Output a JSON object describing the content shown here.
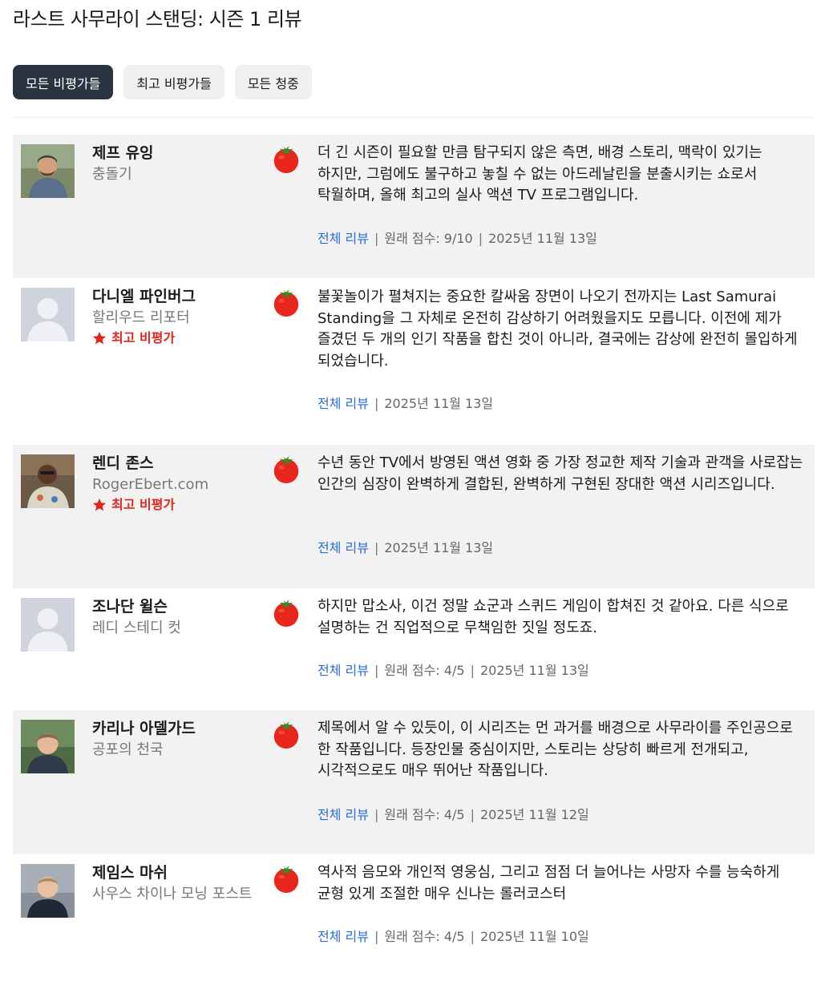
{
  "page": {
    "title": "라스트 사무라이 스탠딩: 시즌 1 리뷰"
  },
  "filters": [
    {
      "label": "모든 비평가들",
      "active": true
    },
    {
      "label": "최고 비평가들",
      "active": false
    },
    {
      "label": "모든 청중",
      "active": false
    }
  ],
  "top_critic_label": "최고 비평가",
  "full_review_label": "전체 리뷰",
  "colors": {
    "accent_link": "#2b6bd6",
    "top_critic": "#e0251b",
    "active_filter": "#2a3440",
    "tomato": "#e8261b"
  },
  "reviews": [
    {
      "name": "제프 유잉",
      "publication": "충돌기",
      "top_critic": false,
      "avatar": "photo",
      "icon": "fresh-tomato-icon",
      "quote": "더 긴 시즌이 필요할 만큼 탐구되지 않은 측면, 배경 스토리, 맥락이 있기는 하지만, 그럼에도 불구하고 놓칠 수 없는 아드레날린을 분출시키는 쇼로서 탁월하며, 올해 최고의 실사 액션 TV 프로그램입니다.",
      "score": "원래 점수: 9/10",
      "date": "2025년 11월 13일"
    },
    {
      "name": "다니엘 파인버그",
      "publication": "할리우드 리포터",
      "top_critic": true,
      "avatar": "placeholder",
      "icon": "fresh-tomato-icon",
      "quote": "불꽃놀이가 펼쳐지는 중요한 칼싸움 장면이 나오기 전까지는 Last Samurai Standing을 그 자체로 온전히 감상하기 어려웠을지도 모릅니다. 이전에 제가 즐겼던 두 개의 인기 작품을 합친 것이 아니라, 결국에는 감상에 완전히 몰입하게 되었습니다.",
      "score": "",
      "date": "2025년 11월 13일"
    },
    {
      "name": "렌디 존스",
      "publication": "RogerEbert.com",
      "top_critic": true,
      "avatar": "photo",
      "icon": "fresh-tomato-icon",
      "quote": "수년 동안 TV에서 방영된 액션 영화 중 가장 정교한 제작 기술과 관객을 사로잡는 인간의 심장이 완벽하게 결합된, 완벽하게 구현된 장대한 액션 시리즈입니다.",
      "score": "",
      "date": "2025년 11월 13일"
    },
    {
      "name": "조나단 윌슨",
      "publication": "레디 스테디 컷",
      "top_critic": false,
      "avatar": "placeholder",
      "icon": "fresh-tomato-icon",
      "quote": "하지만 맙소사, 이건 정말 쇼군과 스퀴드 게임이 합쳐진 것 같아요. 다른 식으로 설명하는 건 직업적으로 무책임한 짓일 정도죠.",
      "score": "원래 점수: 4/5",
      "date": "2025년 11월 13일"
    },
    {
      "name": "카리나 아델가드",
      "publication": "공포의 천국",
      "top_critic": false,
      "avatar": "photo",
      "icon": "fresh-tomato-icon",
      "quote": "제목에서 알 수 있듯이, 이 시리즈는 먼 과거를 배경으로 사무라이를 주인공으로 한 작품입니다. 등장인물 중심이지만, 스토리는 상당히 빠르게 전개되고, 시각적으로도 매우 뛰어난 작품입니다.",
      "score": "원래 점수: 4/5",
      "date": "2025년 11월 12일"
    },
    {
      "name": "제임스 마쉬",
      "publication": "사우스 차이나 모닝 포스트",
      "top_critic": false,
      "avatar": "photo",
      "icon": "fresh-tomato-icon",
      "quote": "역사적 음모와 개인적 영웅심, 그리고 점점 더 늘어나는 사망자 수를 능숙하게 균형 있게 조절한 매우 신나는 롤러코스터",
      "score": "원래 점수: 4/5",
      "date": "2025년 11월 10일"
    }
  ]
}
